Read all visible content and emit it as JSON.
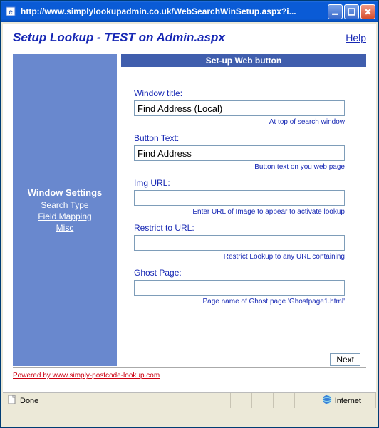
{
  "window": {
    "title": "http://www.simplylookupadmin.co.uk/WebSearchWinSetup.aspx?i..."
  },
  "page": {
    "title": "Setup Lookup - TEST on Admin.aspx",
    "help": "Help",
    "powered": "Powered by www.simply-postcode-lookup.com"
  },
  "sidebar": {
    "selected": "Window Settings",
    "links": [
      "Search Type",
      "Field Mapping",
      "Misc"
    ]
  },
  "section": {
    "heading": "Set-up Web button"
  },
  "form": {
    "window_title": {
      "label": "Window title:",
      "value": "Find Address (Local)",
      "hint": "At top of search window"
    },
    "button_text": {
      "label": "Button Text:",
      "value": "Find Address",
      "hint": "Button text on you web page"
    },
    "img_url": {
      "label": "Img URL:",
      "value": "",
      "hint": "Enter URL of Image to appear to activate lookup"
    },
    "restrict_url": {
      "label": "Restrict to URL:",
      "value": "",
      "hint": "Restrict Lookup to any URL containing"
    },
    "ghost_page": {
      "label": "Ghost Page:",
      "value": "",
      "hint": "Page name of Ghost page 'Ghostpage1.html'"
    }
  },
  "buttons": {
    "next": "Next"
  },
  "statusbar": {
    "status": "Done",
    "zone": "Internet"
  }
}
